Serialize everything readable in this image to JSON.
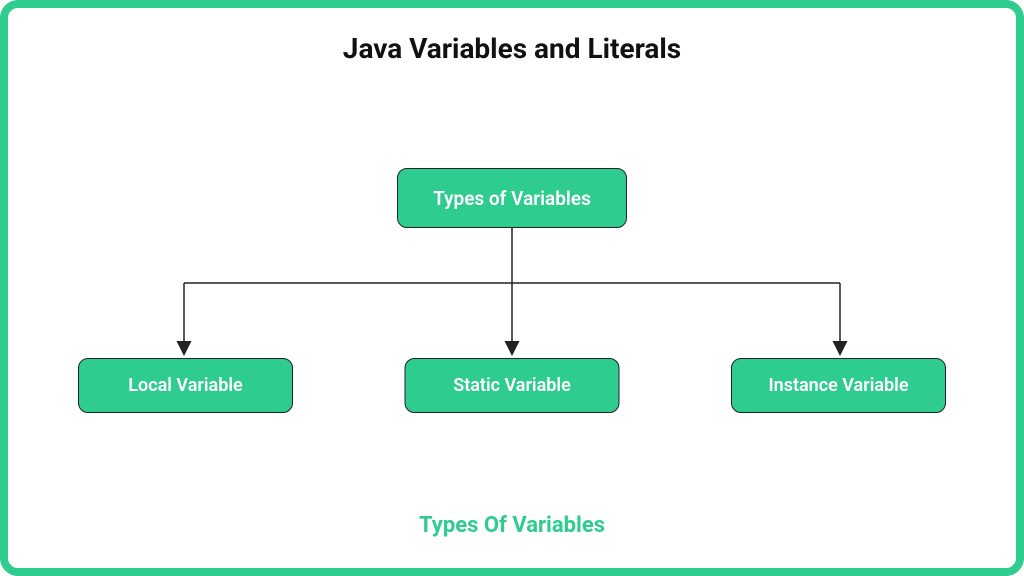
{
  "title": "Java Variables and Literals",
  "root": {
    "label": "Types of Variables"
  },
  "children": [
    {
      "label": "Local Variable"
    },
    {
      "label": "Static Variable"
    },
    {
      "label": "Instance Variable"
    }
  ],
  "caption": "Types Of Variables"
}
